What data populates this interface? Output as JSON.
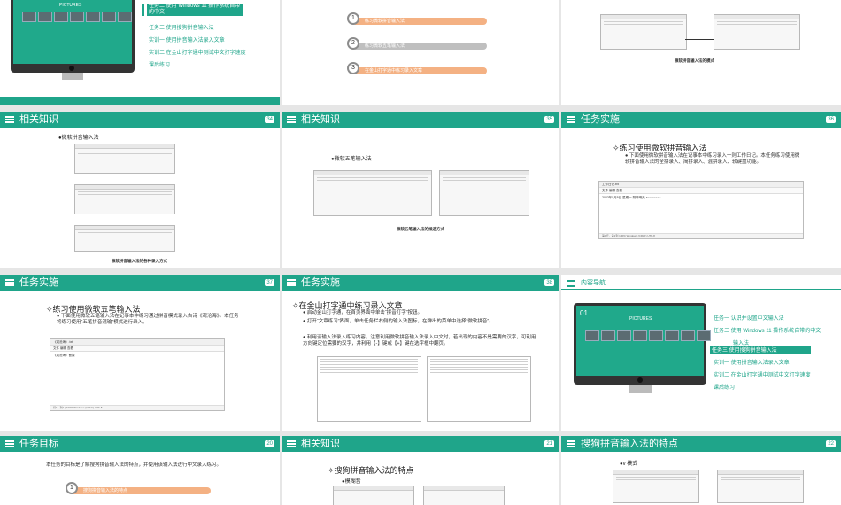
{
  "slides": {
    "s1": {
      "monitor_title": "PICTURES",
      "menu": [
        "任务二  使用 Windows 11 操作系统自带的中文",
        "任务三  使用搜狗拼音输入法",
        "实训一  使用拼音输入法录入文章",
        "实训二  在金山打字通中测试中文打字速度",
        "课后练习"
      ]
    },
    "s2": {
      "steps": [
        {
          "n": "1",
          "label": "练习微软拼音输入法"
        },
        {
          "n": "2",
          "label": "练习微软五笔输入法"
        },
        {
          "n": "3",
          "label": "在金山打字通中练习录入文章"
        }
      ]
    },
    "s3": {
      "caption": "微软拼音输入法的模式"
    },
    "s4": {
      "header": "相关知识",
      "num": "34",
      "h": "●微软拼音输入法",
      "caption": "微软拼音输入法的各种录入方式"
    },
    "s5": {
      "header": "相关知识",
      "num": "35",
      "h": "●微软五笔输入法",
      "caption": "微软五笔输入法的候选方式"
    },
    "s6": {
      "header": "任务实施",
      "num": "36",
      "h": "✧练习使用微软拼音输入法",
      "bullet": "下面使用微软拼音输入法在记事本中练习录入一则工作日记。本任务练习使用微软拼音输入法的全拼录入、简拼录入、混拼录入、软键盘功能。",
      "doc": {
        "title": "工作日记.txt",
        "ribbon": "文件  编辑  查看",
        "text": "2023年5月5日    星期一       阴转晴天  ●○○○○○○○",
        "status": "第1行，第1列   100%   Windows (CRLF)  UTF-8"
      }
    },
    "s7": {
      "header": "任务实施",
      "num": "37",
      "h": "✧练习使用微软五笔输入法",
      "bullet": "下面使用微软五笔输入法在记事本中练习通过拼音模式录入古诗《观沧海》。本任务将练习使用“五笔拼音混输”模式进行录入。",
      "doc": {
        "title": "《观沧海》.txt",
        "ribbon": "文件  编辑  查看",
        "text": "《观沧海》曹操",
        "status": "行1，列1  | 100%    Windows (CRLF)   UTF-8"
      }
    },
    "s8": {
      "header": "任务实施",
      "num": "38",
      "h": "✧在金山打字通中练习录入文章",
      "bullets": [
        "启动金山打字通，在首页界面中单击“拼音打字”按钮。",
        "打开“文章练习”界面，单击任务栏右侧的输入法图标，在弹出的菜单中选择“微软拼音”。",
        "利用该输入法录入练习内容，注意利用微软拼音输入法录入中文时，若出现的内容不是需要的汉字，可利用方向键定位需要的汉字，并利用【-】键或【+】键在选字框中翻页。"
      ]
    },
    "s9": {
      "header": "内容导航",
      "monitor_title": "PICTURES",
      "num_big": "01",
      "menu": [
        "任务一  认识并设置中文输入法",
        "任务二  使用 Windows 11 操作系统自带的中文",
        "输入法",
        "任务三  使用搜狗拼音输入法",
        "实训一  使用拼音输入法录入文章",
        "实训二  在金山打字通中测试中文打字速度",
        "课后练习"
      ],
      "highlight_index": 3
    },
    "s10": {
      "header": "任务目标",
      "num": "20",
      "para": "本任务的目标是了解搜狗拼音输入法的特点，并使用该输入法进行中文录入练习。",
      "step": {
        "n": "1",
        "label": "搜狗拼音输入法的特点"
      }
    },
    "s11": {
      "header": "相关知识",
      "num": "21",
      "h": "✧搜狗拼音输入法的特点",
      "sub": "●模糊音"
    },
    "s12": {
      "header": "搜狗拼音输入法的特点",
      "num": "22",
      "sub": "●v 模式"
    }
  }
}
